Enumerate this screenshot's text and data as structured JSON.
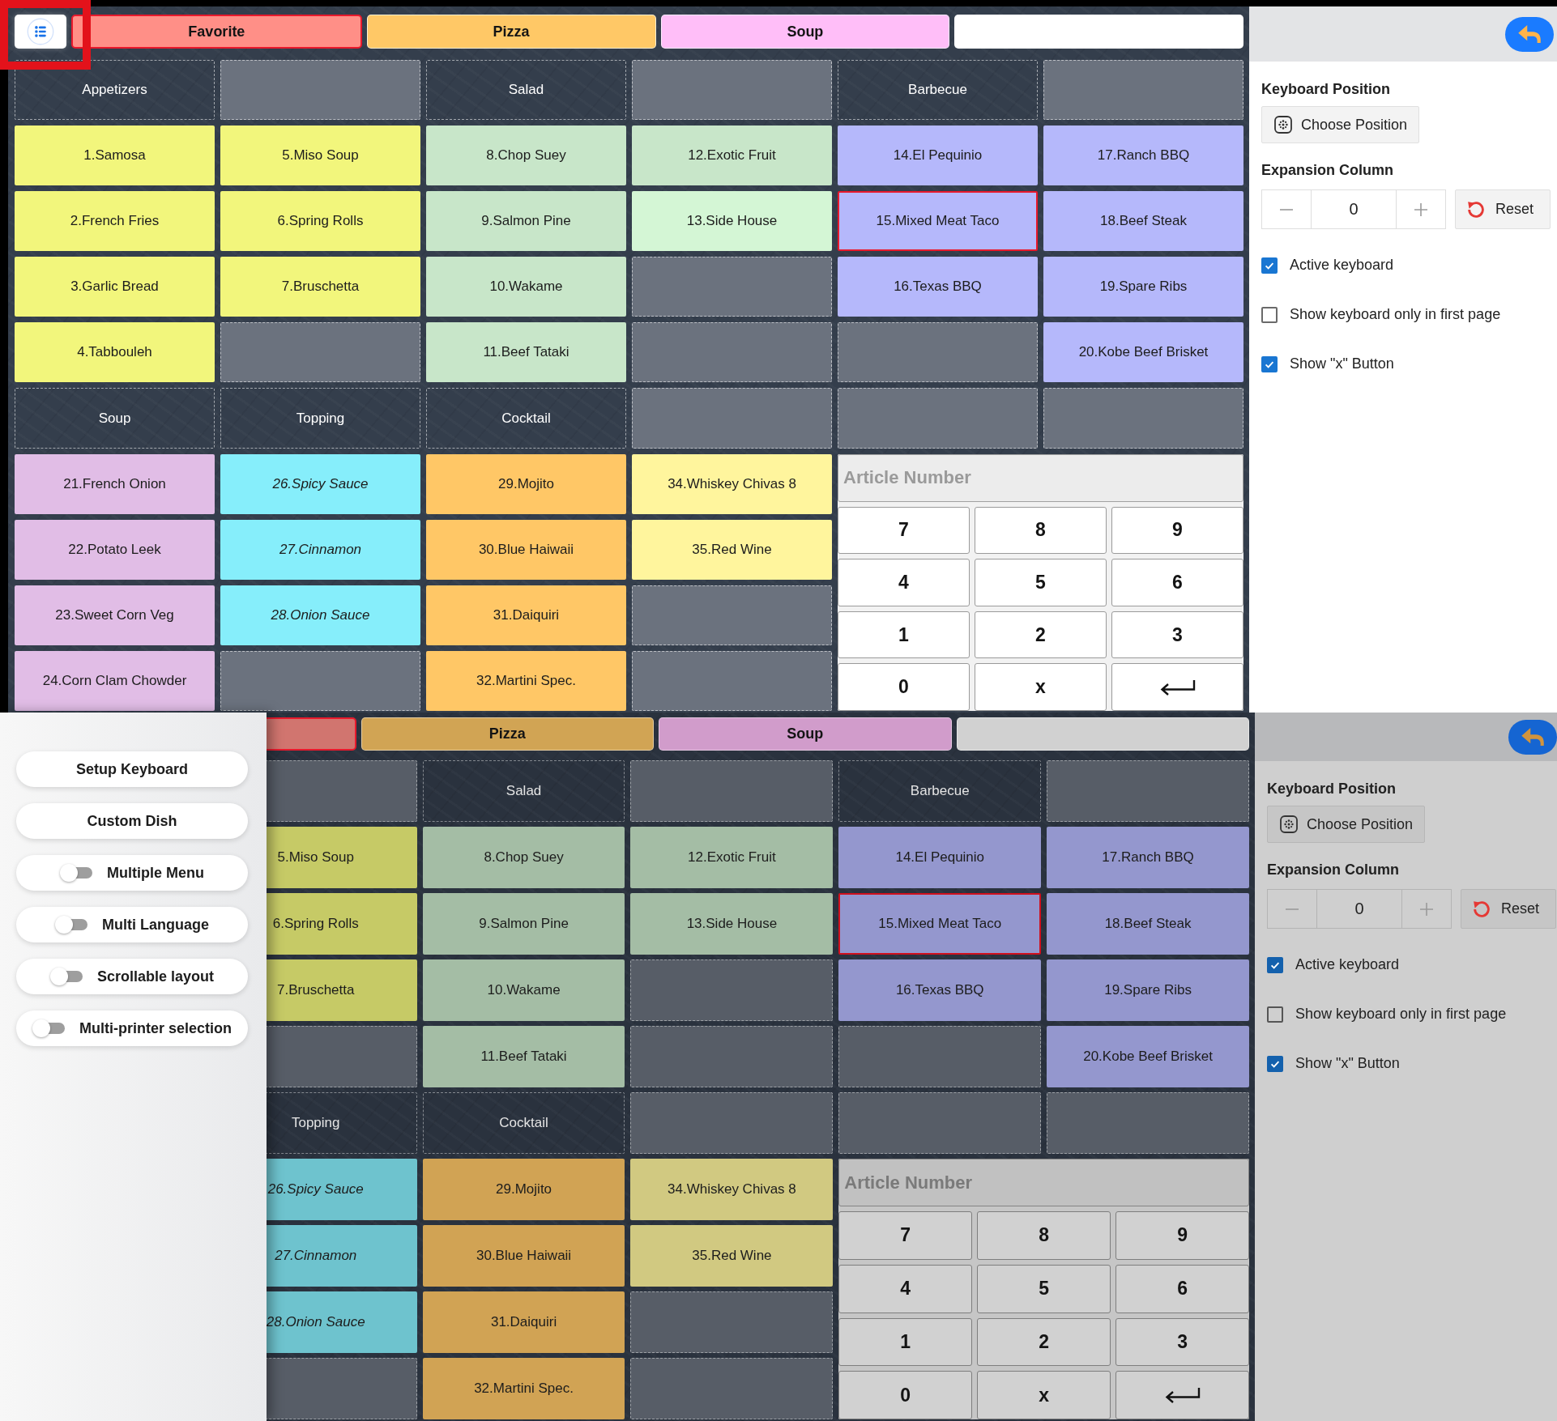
{
  "screens": [
    {
      "menu_button": {
        "highlighted": true
      },
      "tabs": [
        {
          "label": "Favorite",
          "color": "#ff8f87",
          "selected": true
        },
        {
          "label": "Pizza",
          "color": "#ffc866",
          "selected": false
        },
        {
          "label": "Soup",
          "color": "#ffbef8",
          "selected": false
        },
        {
          "color": "#ffffff",
          "selected": false
        }
      ],
      "grid": [
        [
          {
            "kind": "header",
            "label": "Appetizers"
          },
          {
            "kind": "empty"
          },
          {
            "kind": "header",
            "label": "Salad"
          },
          {
            "kind": "empty"
          },
          {
            "kind": "header",
            "label": "Barbecue"
          },
          {
            "kind": "empty"
          }
        ],
        [
          {
            "kind": "item",
            "label": "1.Samosa",
            "color": "#f2f67c",
            "selected": false
          },
          {
            "kind": "item",
            "label": "5.Miso Soup",
            "color": "#f2f67c",
            "selected": false
          },
          {
            "kind": "item",
            "label": "8.Chop Suey",
            "color": "#c8e6c9",
            "selected": false
          },
          {
            "kind": "item",
            "label": "12.Exotic Fruit",
            "color": "#c8e6c9",
            "selected": false
          },
          {
            "kind": "item",
            "label": "14.El Pequinio",
            "color": "#b5b8fb",
            "selected": false
          },
          {
            "kind": "item",
            "label": "17.Ranch BBQ",
            "color": "#b5b8fb",
            "selected": false
          }
        ],
        [
          {
            "kind": "item",
            "label": "2.French Fries",
            "color": "#f2f67c",
            "selected": false
          },
          {
            "kind": "item",
            "label": "6.Spring Rolls",
            "color": "#f2f67c",
            "selected": false
          },
          {
            "kind": "item",
            "label": "9.Salmon Pine",
            "color": "#c8e6c9",
            "selected": false
          },
          {
            "kind": "item",
            "label": "13.Side House",
            "color": "#d4f6d5",
            "selected": false
          },
          {
            "kind": "item",
            "label": "15.Mixed Meat Taco",
            "color": "#b5b8fb",
            "selected": true
          },
          {
            "kind": "item",
            "label": "18.Beef Steak",
            "color": "#b5b8fb",
            "selected": false
          }
        ],
        [
          {
            "kind": "item",
            "label": "3.Garlic Bread",
            "color": "#f2f67c",
            "selected": false
          },
          {
            "kind": "item",
            "label": "7.Bruschetta",
            "color": "#f2f67c",
            "selected": false
          },
          {
            "kind": "item",
            "label": "10.Wakame",
            "color": "#c8e6c9",
            "selected": false
          },
          {
            "kind": "empty"
          },
          {
            "kind": "item",
            "label": "16.Texas BBQ",
            "color": "#b5b8fb",
            "selected": false
          },
          {
            "kind": "item",
            "label": "19.Spare Ribs",
            "color": "#b5b8fb",
            "selected": false
          }
        ],
        [
          {
            "kind": "item",
            "label": "4.Tabbouleh",
            "color": "#f2f67c",
            "selected": false
          },
          {
            "kind": "empty"
          },
          {
            "kind": "item",
            "label": "11.Beef Tataki",
            "color": "#c8e6c9",
            "selected": false
          },
          {
            "kind": "empty"
          },
          {
            "kind": "empty"
          },
          {
            "kind": "item",
            "label": "20.Kobe Beef Brisket",
            "color": "#b5b8fb",
            "selected": false
          }
        ],
        [
          {
            "kind": "header",
            "label": "Soup"
          },
          {
            "kind": "header",
            "label": "Topping"
          },
          {
            "kind": "header",
            "label": "Cocktail"
          },
          {
            "kind": "empty"
          },
          {
            "kind": "empty"
          },
          {
            "kind": "empty"
          }
        ],
        [
          {
            "kind": "item",
            "label": "21.French Onion",
            "color": "#e1bde6",
            "selected": false
          },
          {
            "kind": "extra",
            "label": "26.Spicy Sauce",
            "color": "#86eefb",
            "selected": false
          },
          {
            "kind": "item",
            "label": "29.Mojito",
            "color": "#ffc766",
            "selected": false
          },
          {
            "kind": "item",
            "label": "34.Whiskey Chivas 8",
            "color": "#fff59d",
            "selected": false
          }
        ],
        [
          {
            "kind": "item",
            "label": "22.Potato Leek",
            "color": "#e1bde6",
            "selected": false
          },
          {
            "kind": "extra",
            "label": "27.Cinnamon",
            "color": "#86eefb",
            "selected": false
          },
          {
            "kind": "item",
            "label": "30.Blue Haiwaii",
            "color": "#ffc766",
            "selected": false
          },
          {
            "kind": "item",
            "label": "35.Red Wine",
            "color": "#fff59d",
            "selected": false
          }
        ],
        [
          {
            "kind": "item",
            "label": "23.Sweet Corn Veg",
            "color": "#e1bde6",
            "selected": false
          },
          {
            "kind": "extra",
            "label": "28.Onion Sauce",
            "color": "#86eefb",
            "selected": false
          },
          {
            "kind": "item",
            "label": "31.Daiquiri",
            "color": "#ffc766",
            "selected": false
          },
          {
            "kind": "empty"
          }
        ],
        [
          {
            "kind": "item",
            "label": "24.Corn Clam Chowder",
            "color": "#e1bde6",
            "selected": false
          },
          {
            "kind": "empty"
          },
          {
            "kind": "item",
            "label": "32.Martini Spec.",
            "color": "#ffc766",
            "selected": false
          },
          {
            "kind": "empty"
          }
        ]
      ],
      "keypad": {
        "placeholder": "Article Number",
        "keys": [
          {
            "kind": "char",
            "label": "7"
          },
          {
            "kind": "char",
            "label": "8"
          },
          {
            "kind": "char",
            "label": "9"
          },
          {
            "kind": "char",
            "label": "4"
          },
          {
            "kind": "char",
            "label": "5"
          },
          {
            "kind": "char",
            "label": "6"
          },
          {
            "kind": "char",
            "label": "1"
          },
          {
            "kind": "char",
            "label": "2"
          },
          {
            "kind": "char",
            "label": "3"
          },
          {
            "kind": "char",
            "label": "0"
          },
          {
            "kind": "char",
            "label": "x"
          },
          {
            "kind": "enter"
          }
        ]
      },
      "settings": {
        "position_title": "Keyboard Position",
        "position_button": "Choose Position",
        "column_title": "Expansion Column",
        "column_value": "0",
        "reset_button": "Reset",
        "checkboxes": [
          {
            "label": "Active keyboard",
            "checked": true
          },
          {
            "label": "Show keyboard only in first page",
            "checked": false
          },
          {
            "label": "Show \"x\" Button",
            "checked": true
          }
        ]
      }
    },
    {
      "tabs": [
        {
          "color": "#d1756f",
          "selected": true
        },
        {
          "label": "Pizza",
          "color": "#d1a454",
          "selected": false
        },
        {
          "label": "Soup",
          "color": "#d19ccb",
          "selected": false
        },
        {
          "color": "#d1d1d1",
          "selected": false
        }
      ],
      "grid": [
        [
          {
            "kind": "empty"
          },
          {
            "kind": "header",
            "label": "Salad"
          },
          {
            "kind": "empty"
          },
          {
            "kind": "header",
            "label": "Barbecue"
          },
          {
            "kind": "empty"
          }
        ],
        [
          {
            "kind": "item",
            "label": "5.Miso Soup",
            "color": "#c6ca66",
            "selected": false
          },
          {
            "kind": "item",
            "label": "8.Chop Suey",
            "color": "#a4bda5",
            "selected": false
          },
          {
            "kind": "item",
            "label": "12.Exotic Fruit",
            "color": "#a4bda5",
            "selected": false
          },
          {
            "kind": "item",
            "label": "14.El Pequinio",
            "color": "#9497ce",
            "selected": false
          },
          {
            "kind": "item",
            "label": "17.Ranch BBQ",
            "color": "#9497ce",
            "selected": false
          }
        ],
        [
          {
            "kind": "item",
            "label": "6.Spring Rolls",
            "color": "#c6ca66",
            "selected": false
          },
          {
            "kind": "item",
            "label": "9.Salmon Pine",
            "color": "#a4bda5",
            "selected": false
          },
          {
            "kind": "item",
            "label": "13.Side House",
            "color": "#a4bda5",
            "selected": false
          },
          {
            "kind": "item",
            "label": "15.Mixed Meat Taco",
            "color": "#9497ce",
            "selected": true
          },
          {
            "kind": "item",
            "label": "18.Beef Steak",
            "color": "#9497ce",
            "selected": false
          }
        ],
        [
          {
            "kind": "item",
            "label": "7.Bruschetta",
            "color": "#c6ca66",
            "selected": false
          },
          {
            "kind": "item",
            "label": "10.Wakame",
            "color": "#a4bda5",
            "selected": false
          },
          {
            "kind": "empty"
          },
          {
            "kind": "item",
            "label": "16.Texas BBQ",
            "color": "#9497ce",
            "selected": false
          },
          {
            "kind": "item",
            "label": "19.Spare Ribs",
            "color": "#9497ce",
            "selected": false
          }
        ],
        [
          {
            "kind": "empty"
          },
          {
            "kind": "item",
            "label": "11.Beef Tataki",
            "color": "#a4bda5",
            "selected": false
          },
          {
            "kind": "empty"
          },
          {
            "kind": "empty"
          },
          {
            "kind": "item",
            "label": "20.Kobe Beef Brisket",
            "color": "#9497ce",
            "selected": false
          }
        ],
        [
          {
            "kind": "header",
            "label": "Topping"
          },
          {
            "kind": "header",
            "label": "Cocktail"
          },
          {
            "kind": "empty"
          },
          {
            "kind": "empty"
          },
          {
            "kind": "empty"
          }
        ],
        [
          {
            "kind": "extra",
            "label": "26.Spicy Sauce",
            "color": "#6ec3ce",
            "selected": false
          },
          {
            "kind": "item",
            "label": "29.Mojito",
            "color": "#d1a354",
            "selected": false
          },
          {
            "kind": "item",
            "label": "34.Whiskey Chivas 8",
            "color": "#d1c981",
            "selected": false
          }
        ],
        [
          {
            "kind": "extra",
            "label": "27.Cinnamon",
            "color": "#6ec3ce",
            "selected": false
          },
          {
            "kind": "item",
            "label": "30.Blue Haiwaii",
            "color": "#d1a354",
            "selected": false
          },
          {
            "kind": "item",
            "label": "35.Red Wine",
            "color": "#d1c981",
            "selected": false
          }
        ],
        [
          {
            "kind": "extra",
            "label": "28.Onion Sauce",
            "color": "#6ec3ce",
            "selected": false
          },
          {
            "kind": "item",
            "label": "31.Daiquiri",
            "color": "#d1a354",
            "selected": false
          },
          {
            "kind": "empty"
          }
        ],
        [
          {
            "kind": "empty"
          },
          {
            "kind": "item",
            "label": "32.Martini Spec.",
            "color": "#d1a354",
            "selected": false
          },
          {
            "kind": "empty"
          }
        ]
      ],
      "keypad": {
        "placeholder": "Article Number",
        "keys": [
          {
            "kind": "char",
            "label": "7"
          },
          {
            "kind": "char",
            "label": "8"
          },
          {
            "kind": "char",
            "label": "9"
          },
          {
            "kind": "char",
            "label": "4"
          },
          {
            "kind": "char",
            "label": "5"
          },
          {
            "kind": "char",
            "label": "6"
          },
          {
            "kind": "char",
            "label": "1"
          },
          {
            "kind": "char",
            "label": "2"
          },
          {
            "kind": "char",
            "label": "3"
          },
          {
            "kind": "char",
            "label": "0"
          },
          {
            "kind": "char",
            "label": "x"
          },
          {
            "kind": "enter"
          }
        ]
      },
      "settings": {
        "position_title": "Keyboard Position",
        "position_button": "Choose Position",
        "column_title": "Expansion Column",
        "column_value": "0",
        "reset_button": "Reset",
        "checkboxes": [
          {
            "label": "Active keyboard",
            "checked": true
          },
          {
            "label": "Show keyboard only in first page",
            "checked": false
          },
          {
            "label": "Show \"x\" Button",
            "checked": true
          }
        ]
      },
      "drawer": {
        "items": [
          {
            "kind": "button",
            "label": "Setup Keyboard"
          },
          {
            "kind": "button",
            "label": "Custom Dish"
          },
          {
            "kind": "toggle",
            "label": "Multiple Menu",
            "on": false
          },
          {
            "kind": "toggle",
            "label": "Multi Language",
            "on": false
          },
          {
            "kind": "toggle",
            "label": "Scrollable layout",
            "on": false
          },
          {
            "kind": "toggle",
            "label": "Multi-printer selection",
            "on": false
          }
        ]
      }
    }
  ]
}
